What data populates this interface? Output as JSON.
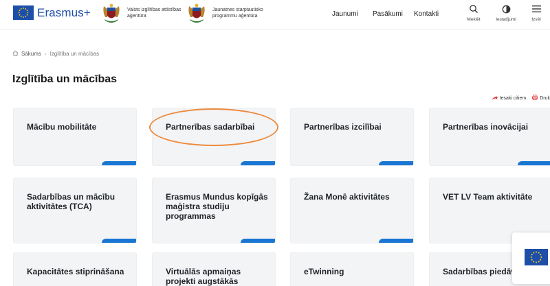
{
  "header": {
    "logo_text": "Erasmus+",
    "agency1": "Valsts izglītības attīstības aģentūra",
    "agency2": "Jaunatnes starptautisko programmu aģentūra",
    "nav": [
      "Jaunumi",
      "Pasākumi",
      "Kontakti"
    ],
    "tools": {
      "search": "Meklēt",
      "accessibility": "Iestatījumi",
      "menu": "Izvēl"
    }
  },
  "breadcrumb": {
    "home": "Sākums",
    "current": "Izglītība un mācības"
  },
  "page_title": "Izglītība un mācības",
  "share": {
    "tell": "Iesaki citiem",
    "print": "Druk"
  },
  "cards": [
    "Mācību mobilitāte",
    "Partnerības sadarbībai",
    "Partnerības izcilībai",
    "Partnerības inovācijai",
    "Sadarbības un mācību aktivitātes (TCA)",
    "Erasmus Mundus kopīgās maģistra studiju programmas",
    "Žana Monē aktivitātes",
    "VET LV Team aktivitāte",
    "Kapacitātes stiprināšana",
    "Virtuālās apmaiņas projekti augstākās",
    "eTwinning",
    "Sadarbības piedāvājumi"
  ],
  "colors": {
    "accent": "#1976d2",
    "brand": "#1d4fa8",
    "highlight": "#ee8a3c",
    "card_bg": "#f3f4f6"
  },
  "icons": [
    "eu-flag-icon",
    "coat-of-arms-icon",
    "search-icon",
    "accessibility-icon",
    "menu-icon",
    "home-icon",
    "share-icon",
    "print-icon"
  ]
}
